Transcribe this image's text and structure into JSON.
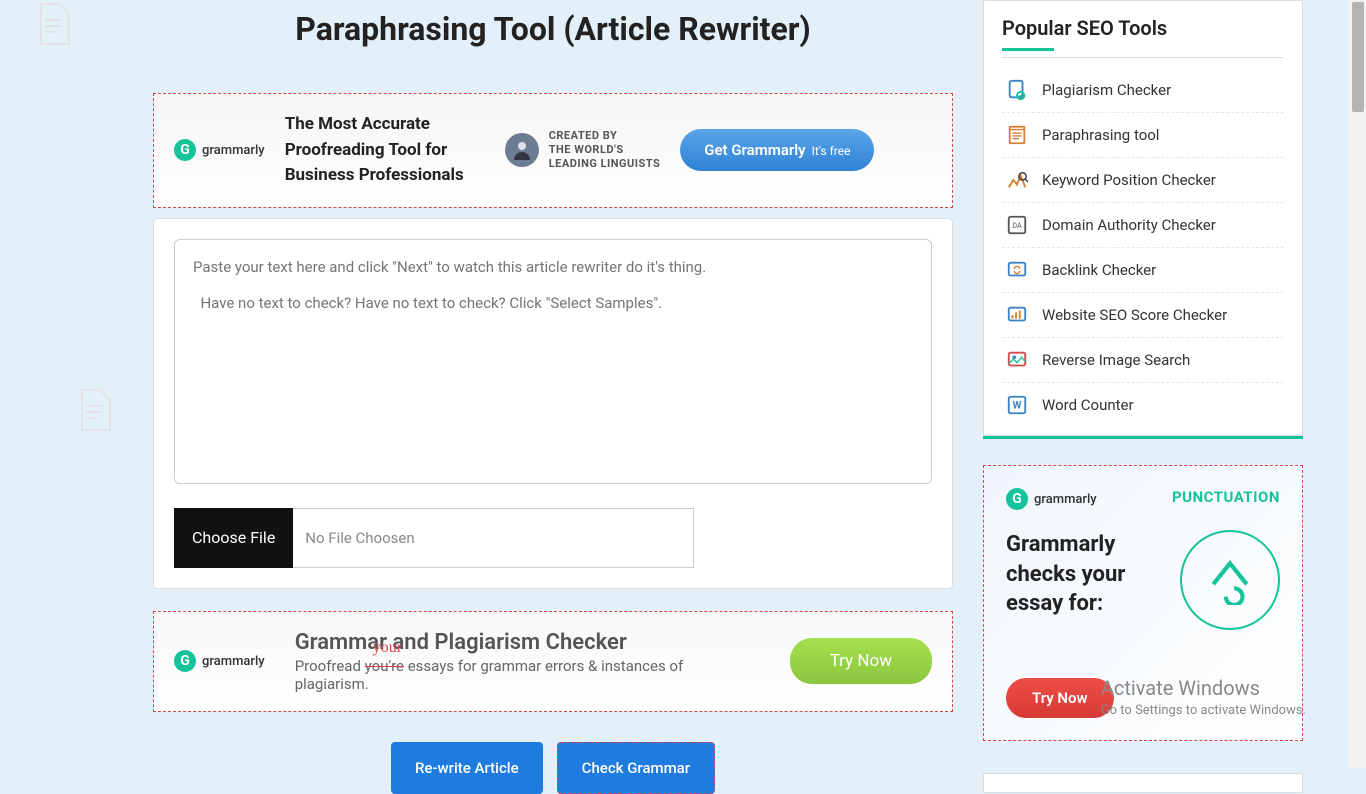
{
  "page": {
    "title": "Paraphrasing Tool (Article Rewriter)"
  },
  "ad1": {
    "brand": "grammarly",
    "headline": "The Most Accurate Proofreading Tool for Business Professionals",
    "caption_line1": "CREATED BY",
    "caption_line2": "THE WORLD'S",
    "caption_line3": "LEADING LINGUISTS",
    "button_main": "Get Grammarly",
    "button_sub": "It's free"
  },
  "tool": {
    "placeholder": "Paste your text here and click \"Next\" to watch this article rewriter do it's thing.\n\n  Have no text to check? Have no text to check? Click \"Select Samples\".",
    "choose_file_label": "Choose File",
    "no_file_text": "No File Choosen"
  },
  "ad2": {
    "brand": "grammarly",
    "title": "Grammar and Plagiarism Checker",
    "sub_prefix": "Proofread ",
    "sub_strike": "you're",
    "sub_your": "your",
    "sub_rest": " essays for grammar errors & instances of plagiarism.",
    "button": "Try Now"
  },
  "actions": {
    "rewrite": "Re-write Article",
    "check_grammar": "Check Grammar"
  },
  "sidebar": {
    "title": "Popular SEO Tools",
    "items": [
      {
        "label": "Plagiarism Checker"
      },
      {
        "label": "Paraphrasing tool"
      },
      {
        "label": "Keyword Position Checker"
      },
      {
        "label": "Domain Authority Checker"
      },
      {
        "label": "Backlink Checker"
      },
      {
        "label": "Website SEO Score Checker"
      },
      {
        "label": "Reverse Image Search"
      },
      {
        "label": "Word Counter"
      }
    ]
  },
  "ad3": {
    "brand": "grammarly",
    "tag": "PUNCTUATION",
    "headline": "Grammarly checks your essay for:",
    "button": "Try Now"
  },
  "watermark": {
    "title": "Activate Windows",
    "sub": "Go to Settings to activate Windows."
  }
}
